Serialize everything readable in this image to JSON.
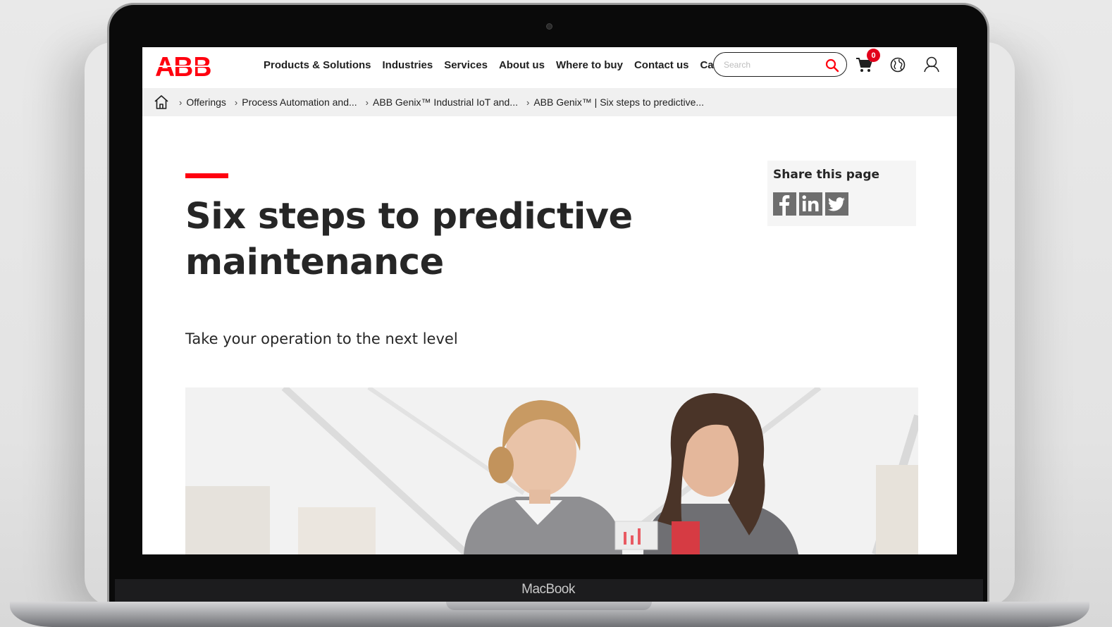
{
  "device": {
    "label": "MacBook"
  },
  "header": {
    "logo_text": "ABB",
    "nav": [
      {
        "label": "Products & Solutions"
      },
      {
        "label": "Industries"
      },
      {
        "label": "Services"
      },
      {
        "label": "About us"
      },
      {
        "label": "Where to buy"
      },
      {
        "label": "Contact us"
      },
      {
        "label": "Ca"
      }
    ],
    "search_placeholder": "Search",
    "cart_count": "0"
  },
  "breadcrumb": [
    {
      "label": "Offerings"
    },
    {
      "label": "Process Automation and..."
    },
    {
      "label": "ABB Genix™ Industrial IoT and..."
    },
    {
      "label": "ABB Genix™ | Six steps to predictive..."
    }
  ],
  "main": {
    "title_line1": "Six steps to predictive",
    "title_line2": "maintenance",
    "subtitle": "Take your operation to the next level"
  },
  "share": {
    "title": "Share this page",
    "networks": [
      "facebook",
      "linkedin",
      "twitter"
    ]
  },
  "colors": {
    "brand_red": "#ff000f",
    "badge_red": "#e2001a"
  }
}
